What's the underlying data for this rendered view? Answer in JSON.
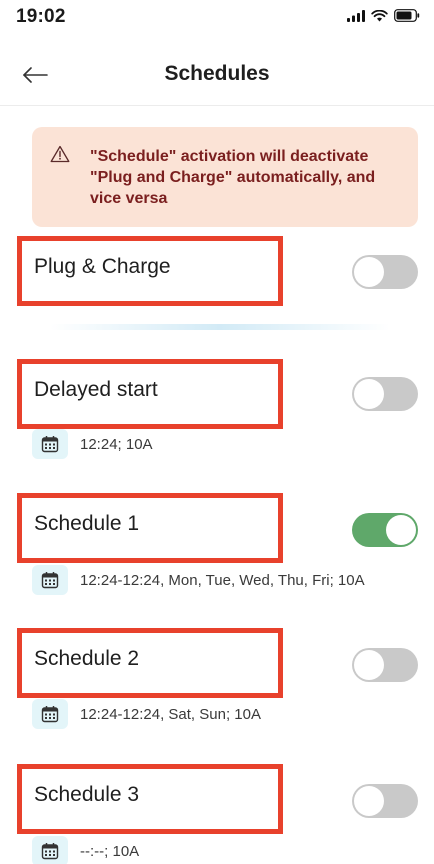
{
  "status_bar": {
    "time": "19:02"
  },
  "header": {
    "title": "Schedules"
  },
  "warning": {
    "text": "\"Schedule\" activation will deactivate \"Plug and Charge\" automatically, and vice versa"
  },
  "plug_charge": {
    "label": "Plug & Charge",
    "enabled": false
  },
  "delayed_start": {
    "label": "Delayed start",
    "detail": "12:24; 10A",
    "enabled": false
  },
  "schedule_1": {
    "label": "Schedule 1",
    "detail": "12:24-12:24, Mon, Tue, Wed, Thu, Fri; 10A",
    "enabled": true
  },
  "schedule_2": {
    "label": "Schedule 2",
    "detail": "12:24-12:24, Sat, Sun; 10A",
    "enabled": false
  },
  "schedule_3": {
    "label": "Schedule 3",
    "detail": "--:--; 10A",
    "enabled": false
  },
  "colors": {
    "highlight_border": "#e8412c",
    "toggle_on": "#5fa86a",
    "toggle_off": "#c9c9c9",
    "warning_bg": "#fbe3d6",
    "warning_text": "#7a1f1f",
    "calendar_badge_bg": "#e3f5f9"
  },
  "icons": {
    "back": "arrow-left-icon",
    "warning": "warning-triangle-icon",
    "calendar": "calendar-icon",
    "signal": "cellular-signal-icon",
    "wifi": "wifi-icon",
    "battery": "battery-icon"
  }
}
